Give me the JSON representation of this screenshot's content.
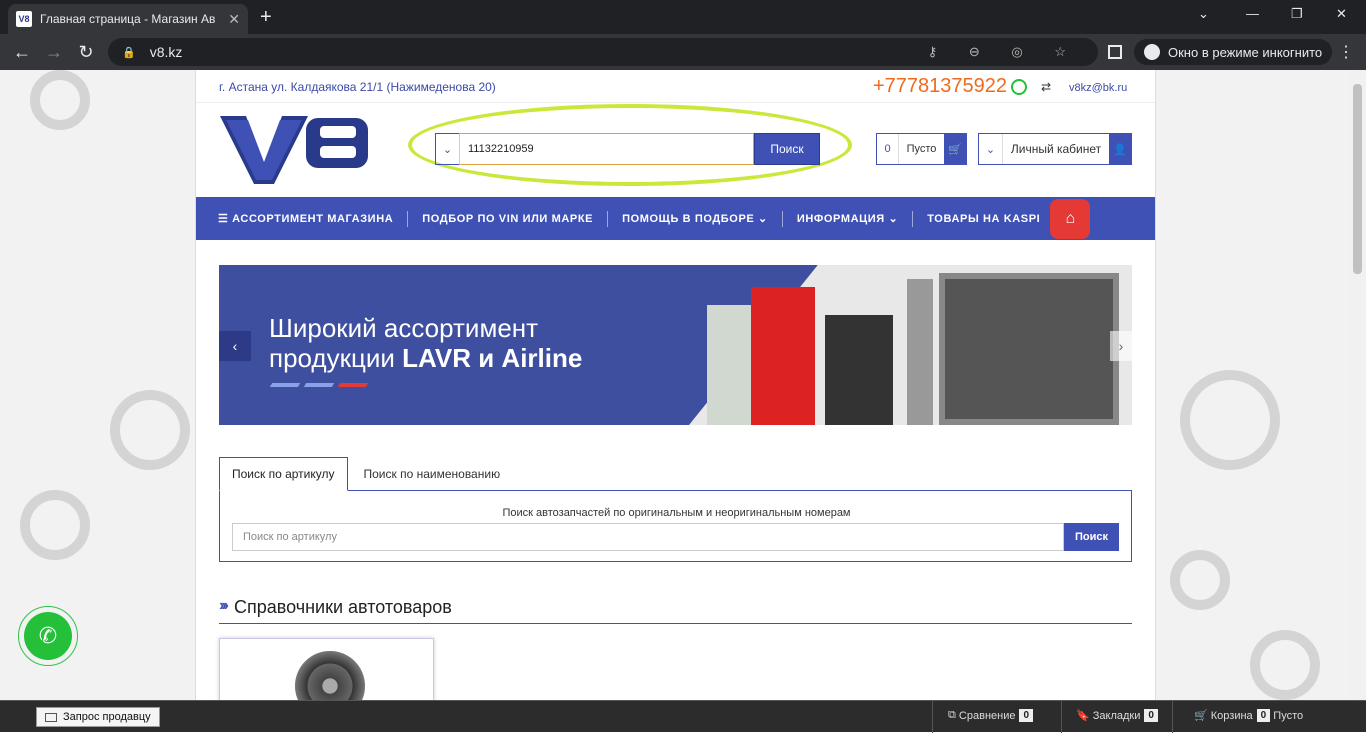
{
  "browser": {
    "tab_title": "Главная страница - Магазин Ав",
    "tab_favicon": "V8",
    "url": "v8.kz",
    "incognito_label": "Окно в режиме инкогнито"
  },
  "site": {
    "address": "г. Астана ул. Калдаякова 21/1 (Нажимеденова 20)",
    "phone": "+77781375922",
    "email": "v8kz@bk.ru",
    "logo_text": "V8",
    "search": {
      "value": "11132210959",
      "button": "Поиск"
    },
    "cart": {
      "count": "0",
      "label": "Пусто"
    },
    "account_label": "Личный кабинет",
    "nav": [
      {
        "label": "АССОРТИМЕНТ МАГАЗИНА"
      },
      {
        "label": "ПОДБОР ПО VIN ИЛИ МАРКЕ"
      },
      {
        "label": "ПОМОЩЬ В ПОДБОРЕ"
      },
      {
        "label": "ИНФОРМАЦИЯ"
      },
      {
        "label": "ТОВАРЫ НА KASPI"
      }
    ],
    "banner": {
      "line1": "Широкий ассортимент",
      "line2_prefix": "продукции ",
      "line2_bold": "LAVR и Airline",
      "stripe_colors": [
        "#8aa0e8",
        "#8aa0e8",
        "#e53935"
      ]
    },
    "search_tabs": [
      "Поиск по артикулу",
      "Поиск по наименованию"
    ],
    "article_search": {
      "description": "Поиск автозапчастей по оригинальным и неоригинальным номерам",
      "placeholder": "Поиск по артикулу",
      "button": "Поиск"
    },
    "section_title": "Справочники автотоваров",
    "section_arrows": "›››"
  },
  "bottom_bar": {
    "seller_request": "Запрос продавцу",
    "compare_label": "Сравнение",
    "compare_count": "0",
    "bookmarks_label": "Закладки",
    "bookmarks_count": "0",
    "cart_label": "Корзина",
    "cart_count": "0",
    "cart_status": "Пусто"
  },
  "colors": {
    "brand_blue": "#3f51b5",
    "phone_orange": "#f06a1e",
    "highlight_green": "#c9e83a",
    "kaspi_red": "#e53935",
    "whatsapp_green": "#25c03a"
  }
}
